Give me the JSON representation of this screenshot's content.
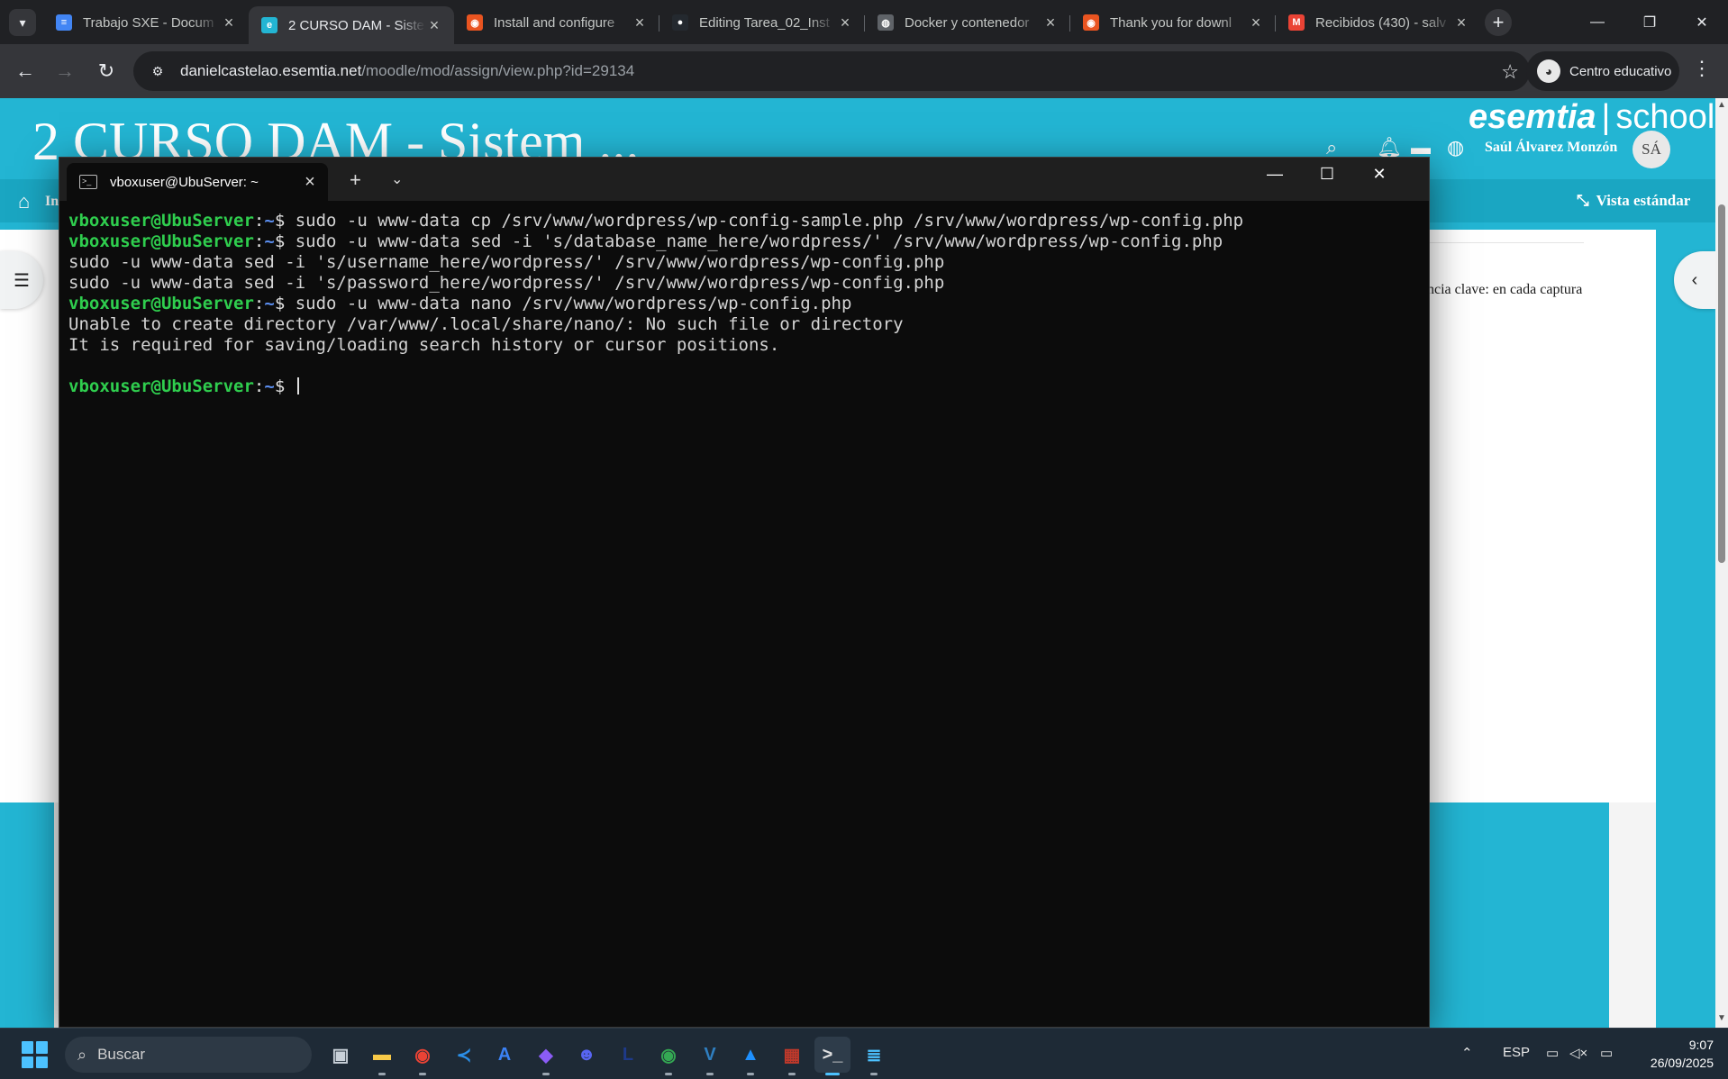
{
  "browser": {
    "tabs": [
      {
        "title": "Trabajo SXE - Docum",
        "icon": "docs-icon",
        "color": "#4285f4",
        "glyph": "≡"
      },
      {
        "title": "2 CURSO DAM - Siste",
        "icon": "esemtia-icon",
        "color": "#23b5d3",
        "glyph": "e"
      },
      {
        "title": "Install and configure",
        "icon": "ubuntu-icon",
        "color": "#e95420",
        "glyph": "◉"
      },
      {
        "title": "Editing Tarea_02_Inst",
        "icon": "github-icon",
        "color": "#24292f",
        "glyph": "●"
      },
      {
        "title": "Docker y contenedor",
        "icon": "globe-icon",
        "color": "#5f6368",
        "glyph": "◍"
      },
      {
        "title": "Thank you for downl",
        "icon": "ubuntu-icon",
        "color": "#e95420",
        "glyph": "◉"
      },
      {
        "title": "Recibidos (430) - salv",
        "icon": "gmail-icon",
        "color": "#ea4335",
        "glyph": "M"
      }
    ],
    "url_host": "danielcastelao.esemtia.net",
    "url_path": "/moodle/mod/assign/view.php?id=29134",
    "profile_label": "Centro educativo"
  },
  "page": {
    "site_title": "2 CURSO DAM - Sistem ...",
    "brand_bold": "esemtia",
    "brand_sep": "|",
    "brand_light": "school",
    "user_name": "Saúl Álvarez Monzón",
    "user_initials": "SÁ",
    "home_label": "In",
    "vista_label": "Vista estándar",
    "content_snippet": "ncia clave: en cada captura",
    "notification_count": "0"
  },
  "terminal": {
    "tab_title": "vboxuser@UbuServer: ~",
    "prompt_user": "vboxuser@UbuServer",
    "prompt_path": "~",
    "lines": [
      {
        "prompt": true,
        "text": "sudo -u www-data cp /srv/www/wordpress/wp-config-sample.php /srv/www/wordpress/wp-config.php"
      },
      {
        "prompt": true,
        "text": "sudo -u www-data sed -i 's/database_name_here/wordpress/' /srv/www/wordpress/wp-config.php"
      },
      {
        "prompt": false,
        "text": "sudo -u www-data sed -i 's/username_here/wordpress/' /srv/www/wordpress/wp-config.php"
      },
      {
        "prompt": false,
        "text": "sudo -u www-data sed -i 's/password_here/wordpress/' /srv/www/wordpress/wp-config.php"
      },
      {
        "prompt": true,
        "text": "sudo -u www-data nano /srv/www/wordpress/wp-config.php"
      },
      {
        "prompt": false,
        "text": "Unable to create directory /var/www/.local/share/nano/: No such file or directory"
      },
      {
        "prompt": false,
        "text": "It is required for saving/loading search history or cursor positions."
      },
      {
        "prompt": false,
        "text": ""
      },
      {
        "prompt": true,
        "text": "",
        "cursor": true
      }
    ]
  },
  "taskbar": {
    "search_placeholder": "Buscar",
    "apps": [
      {
        "name": "taskview-icon",
        "glyph": "▣",
        "color": "#c9d1d9"
      },
      {
        "name": "file-explorer-icon",
        "glyph": "▬",
        "color": "#f7c948"
      },
      {
        "name": "chrome-icon",
        "glyph": "◉",
        "color": "#ea4335"
      },
      {
        "name": "vscode-icon",
        "glyph": "≺",
        "color": "#2b8fe8"
      },
      {
        "name": "app-a-icon",
        "glyph": "A",
        "color": "#3b82f6"
      },
      {
        "name": "obsidian-icon",
        "glyph": "◆",
        "color": "#8b5cf6"
      },
      {
        "name": "discord-icon",
        "glyph": "☻",
        "color": "#5865f2"
      },
      {
        "name": "app-l-icon",
        "glyph": "L",
        "color": "#1e3a8a"
      },
      {
        "name": "chrome-profile-icon",
        "glyph": "◉",
        "color": "#34a853"
      },
      {
        "name": "virtualbox-icon",
        "glyph": "V",
        "color": "#2f7fc1"
      },
      {
        "name": "paint-icon",
        "glyph": "▲",
        "color": "#1e90ff"
      },
      {
        "name": "winrar-icon",
        "glyph": "▦",
        "color": "#c0392b"
      },
      {
        "name": "terminal-icon",
        "glyph": ">_",
        "color": "#e0e0e0"
      },
      {
        "name": "notepad-icon",
        "glyph": "≣",
        "color": "#4cc2ff"
      }
    ],
    "language": "ESP",
    "time": "9:07",
    "date": "26/09/2025"
  }
}
